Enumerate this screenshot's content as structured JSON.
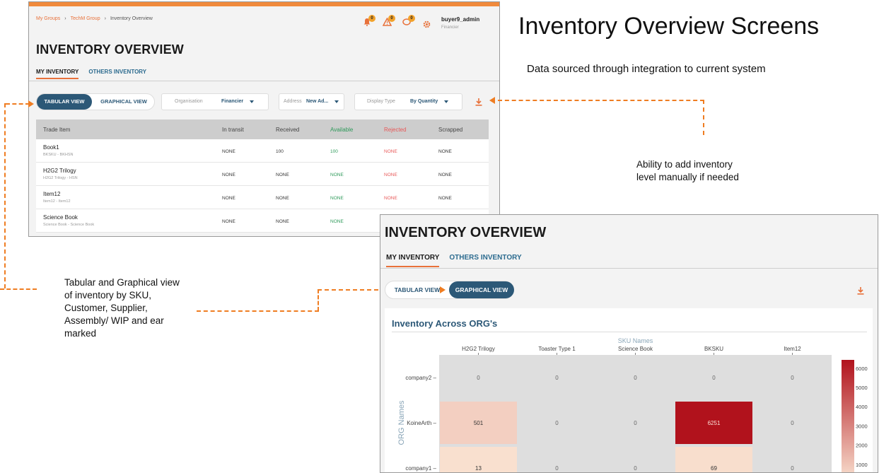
{
  "screen1": {
    "breadcrumb": [
      "My Groups",
      "TechM Group",
      "Inventory Overview"
    ],
    "notifications": [
      "0",
      "0",
      "0"
    ],
    "user": {
      "name": "buyer9_admin",
      "role": "Financier"
    },
    "title": "INVENTORY OVERVIEW",
    "tabs": [
      "MY INVENTORY",
      "OTHERS INVENTORY"
    ],
    "view_toggle": {
      "tabular": "TABULAR VIEW",
      "graphical": "GRAPHICAL VIEW"
    },
    "filters": {
      "organisation": {
        "label": "Organisation",
        "value": "Financier"
      },
      "address": {
        "label": "Address",
        "value": "New Ad..."
      },
      "display_type": {
        "label": "Display Type",
        "value": "By Quantity"
      }
    },
    "table": {
      "columns": [
        "Trade Item",
        "In transit",
        "Received",
        "Available",
        "Rejected",
        "Scrapped"
      ],
      "rows": [
        {
          "name": "Book1",
          "sub": "BKSKU - BKHSN",
          "in_transit": "NONE",
          "received": "100",
          "available": "100",
          "rejected": "NONE",
          "scrapped": "NONE"
        },
        {
          "name": "H2G2 Trilogy",
          "sub": "H2G2 Trilogy - HSN",
          "in_transit": "NONE",
          "received": "NONE",
          "available": "NONE",
          "rejected": "NONE",
          "scrapped": "NONE"
        },
        {
          "name": "Item12",
          "sub": "Item12 - Item12",
          "in_transit": "NONE",
          "received": "NONE",
          "available": "NONE",
          "rejected": "NONE",
          "scrapped": "NONE"
        },
        {
          "name": "Science Book",
          "sub": "Science Book - Science Book",
          "in_transit": "NONE",
          "received": "NONE",
          "available": "NONE",
          "rejected": "",
          "scrapped": ""
        }
      ]
    }
  },
  "annotations": {
    "heading": "Inventory Overview Screens",
    "data_sourced": "Data sourced through integration to current system",
    "manual_add": [
      "Ability to add inventory",
      "level manually if needed"
    ],
    "views": [
      "Tabular and Graphical view",
      "of inventory by SKU,",
      "Customer, Supplier,",
      "Assembly/ WIP and ear",
      "marked"
    ],
    "accent_color": "#ef7d22"
  },
  "screen2": {
    "title": "INVENTORY OVERVIEW",
    "tabs": [
      "MY INVENTORY",
      "OTHERS INVENTORY"
    ],
    "view_toggle": {
      "tabular": "TABULAR VIEW",
      "graphical": "GRAPHICAL VIEW"
    },
    "chart_title": "Inventory Across ORG's"
  },
  "chart_data": {
    "type": "heatmap",
    "title": "Inventory Across ORG's",
    "xlabel": "SKU Names",
    "ylabel": "ORG Names",
    "x": [
      "H2G2 Trilogy",
      "Toaster Type 1",
      "Science Book",
      "BKSKU",
      "Item12"
    ],
    "y": [
      "company2",
      "KoineArth",
      "company1"
    ],
    "values": [
      [
        0,
        0,
        0,
        0,
        0
      ],
      [
        501,
        0,
        0,
        6251,
        0
      ],
      [
        13,
        0,
        0,
        69,
        0
      ]
    ],
    "colorbar": {
      "ticks": [
        1000,
        2000,
        3000,
        4000,
        5000,
        6000
      ],
      "range": [
        0,
        6251
      ],
      "low_color": "#f9e0cf",
      "high_color": "#b1121c"
    },
    "empty_color": "#dedede"
  }
}
